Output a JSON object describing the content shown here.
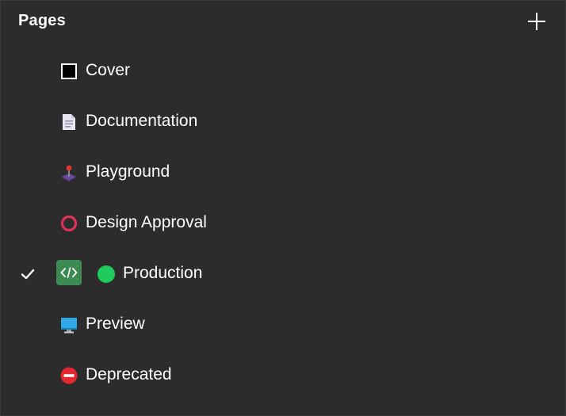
{
  "header": {
    "title": "Pages",
    "add_icon": "plus-icon"
  },
  "pages": [
    {
      "label": "Cover",
      "icon": "black-square-icon"
    },
    {
      "label": "Documentation",
      "icon": "document-icon"
    },
    {
      "label": "Playground",
      "icon": "joystick-icon"
    },
    {
      "label": "Design Approval",
      "icon": "red-circle-icon"
    },
    {
      "label": "Production",
      "icon": "green-circle-icon",
      "selected": true,
      "badge_icon": "code-icon",
      "check_icon": "checkmark-icon"
    },
    {
      "label": "Preview",
      "icon": "monitor-icon"
    },
    {
      "label": "Deprecated",
      "icon": "no-entry-icon"
    }
  ],
  "colors": {
    "background": "#2c2c2c",
    "text": "#ffffff",
    "approval_red": "#e0315a",
    "production_green": "#1ecb5c",
    "code_badge_green": "#3d8a52",
    "preview_blue": "#2ea8e6",
    "deprecated_red": "#e4262f"
  }
}
